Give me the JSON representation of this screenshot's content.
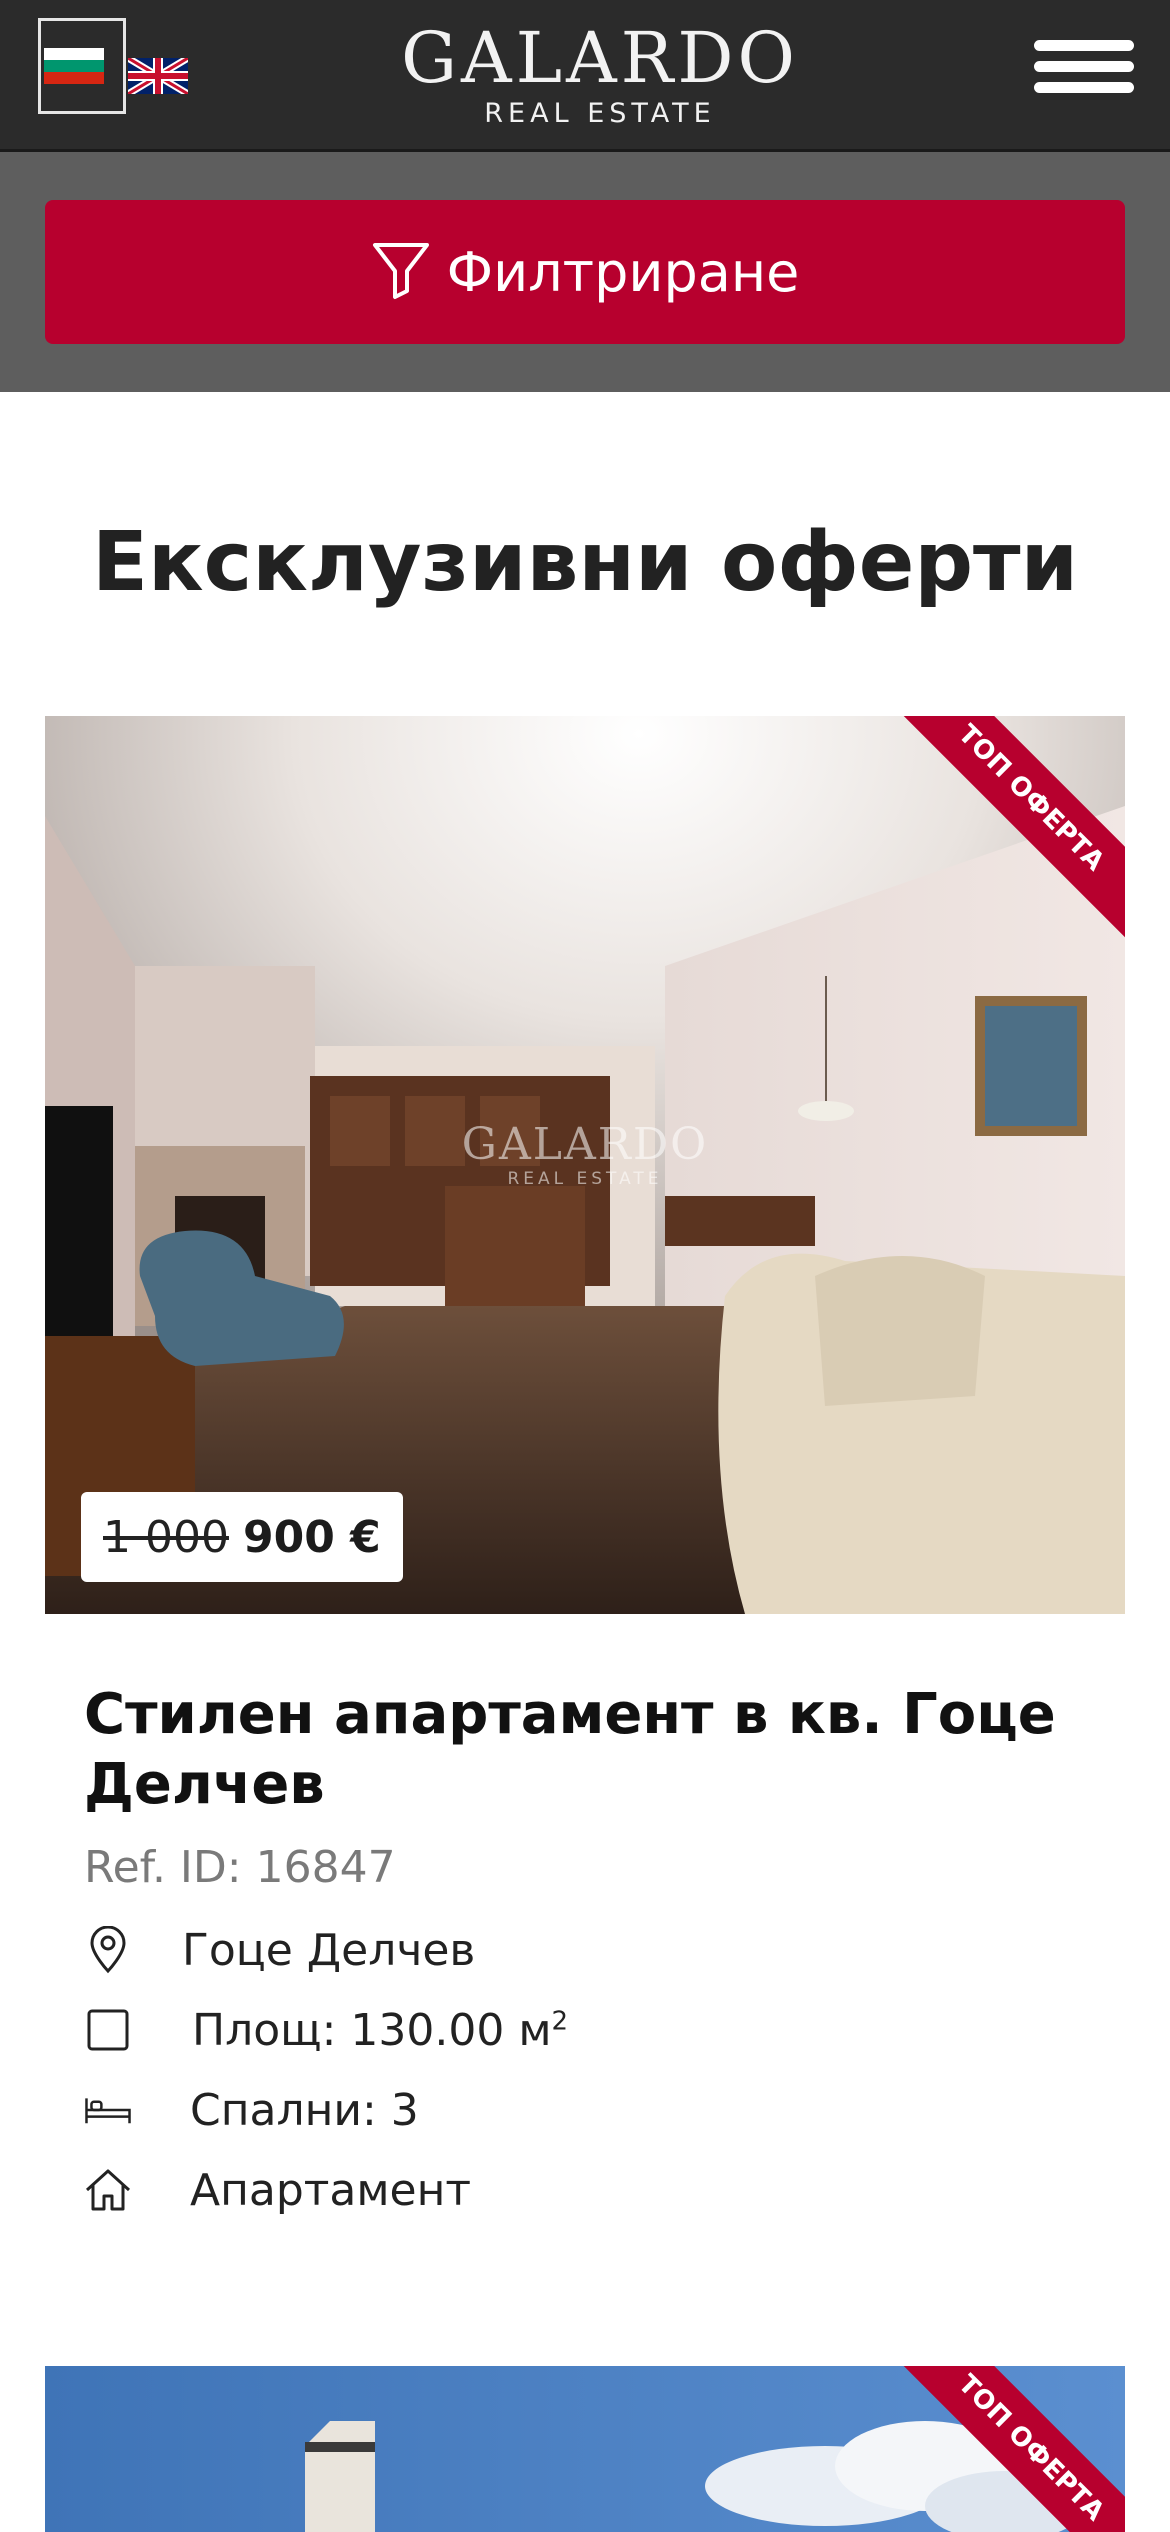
{
  "header": {
    "logo_main": "GALARDO",
    "logo_sub": "REAL ESTATE",
    "languages": [
      "BG",
      "EN"
    ]
  },
  "filter": {
    "label": "Филтриране"
  },
  "section": {
    "title": "Ексклузивни оферти"
  },
  "listings": [
    {
      "badge": "ТОП ОФЕРТА",
      "watermark_main": "GALARDO",
      "watermark_sub": "REAL ESTATE",
      "price_old": "1 000",
      "price_new": "900 €",
      "title": "Стилен апартамент в кв. Гоце Делчев",
      "ref": "Ref. ID: 16847",
      "location": "Гоце Делчев",
      "area": "Площ: 130.00 м",
      "area_unit_sup": "2",
      "bedrooms": "Спални: 3",
      "type": "Апартамент"
    },
    {
      "badge": "ТОП ОФЕРТА"
    }
  ],
  "colors": {
    "header_bg": "#2b2b2b",
    "filter_bar_bg": "#5e5e5e",
    "accent": "#b7002e"
  }
}
